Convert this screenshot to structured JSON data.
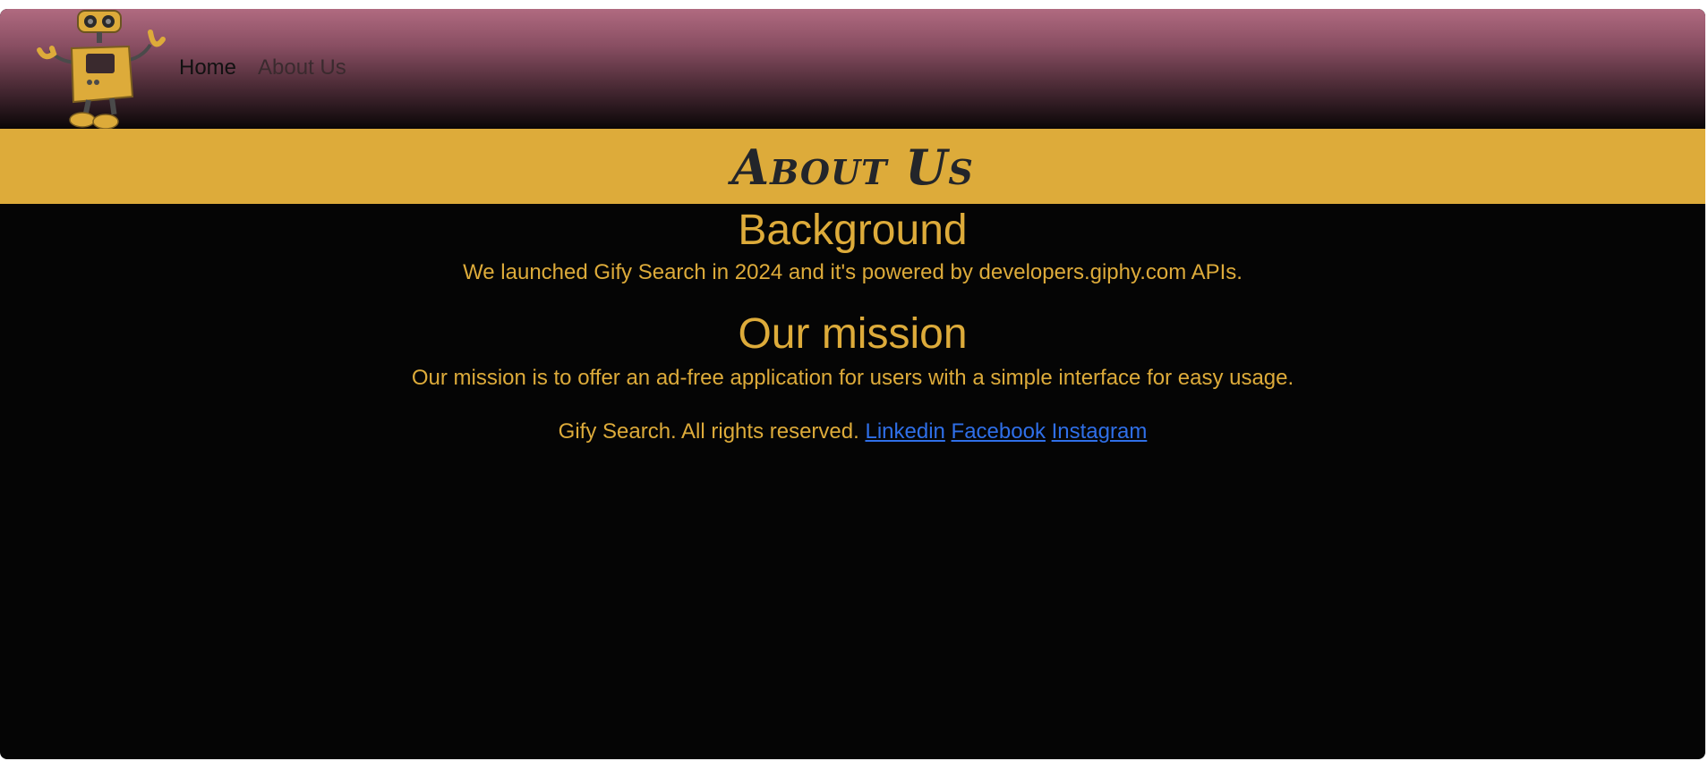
{
  "nav": {
    "home_label": "Home",
    "about_label": "About Us"
  },
  "logo": {
    "icon": "robot-mascot-icon"
  },
  "banner": {
    "title": "About Us"
  },
  "background": {
    "heading": "Background",
    "text": "We launched Gify Search in 2024 and it's powered by developers.giphy.com APIs."
  },
  "mission": {
    "heading": "Our mission",
    "text": "Our mission is to offer an ad-free application for users with a simple interface for easy usage."
  },
  "footer": {
    "copyright": "Gify Search. All rights reserved.",
    "links": [
      "Linkedin",
      "Facebook",
      "Instagram"
    ]
  },
  "colors": {
    "accent": "#ddab3a",
    "background": "#050505",
    "link": "#2f6fe8",
    "navbar_top": "#b06a80"
  }
}
